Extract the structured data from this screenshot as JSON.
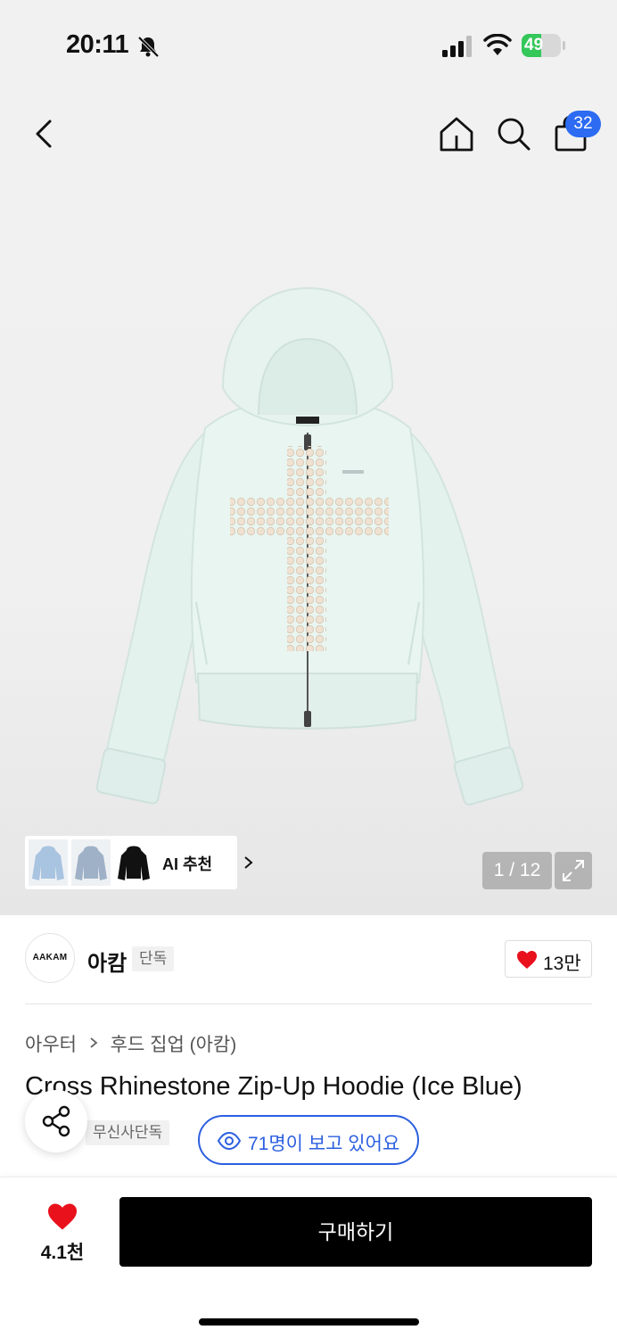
{
  "status_bar": {
    "time": "20:11",
    "battery_level": "49",
    "battery_fraction": 0.49,
    "icons": [
      "bell-slash-icon",
      "cellular-signal-icon",
      "wifi-icon",
      "battery-charging-icon"
    ]
  },
  "nav": {
    "back_icon": "chevron-left-icon",
    "home_icon": "home-icon",
    "search_icon": "search-icon",
    "cart_icon": "shopping-bag-icon",
    "cart_count": "32"
  },
  "gallery": {
    "current": 1,
    "total": 12,
    "indicator": "1 / 12",
    "ai_recommend_label": "AI 추천",
    "thumbnail_colors": [
      "#a9c4e0",
      "#9fb1c6",
      "#111111"
    ]
  },
  "brand": {
    "logo_text": "AAKAM",
    "name": "아캄",
    "exclusive_tag": "단독",
    "likes": "13만"
  },
  "breadcrumb": {
    "category": "아우터",
    "subcategory": "후드 집업 (아캄)"
  },
  "product": {
    "title": "Cross Rhinestone Zip-Up Hoodie (Ice Blue)",
    "store_tag": "무신사단독",
    "viewers": "71명이 보고 있어요"
  },
  "bottom_bar": {
    "wishlist_count": "4.1천",
    "buy_label": "구매하기"
  },
  "colors": {
    "accent_blue": "#2c5fe0",
    "badge_blue": "#2c6bf2",
    "heart_red": "#e8111c",
    "battery_green": "#34c759",
    "hoodie_ice_blue": "#e6f3ef"
  }
}
